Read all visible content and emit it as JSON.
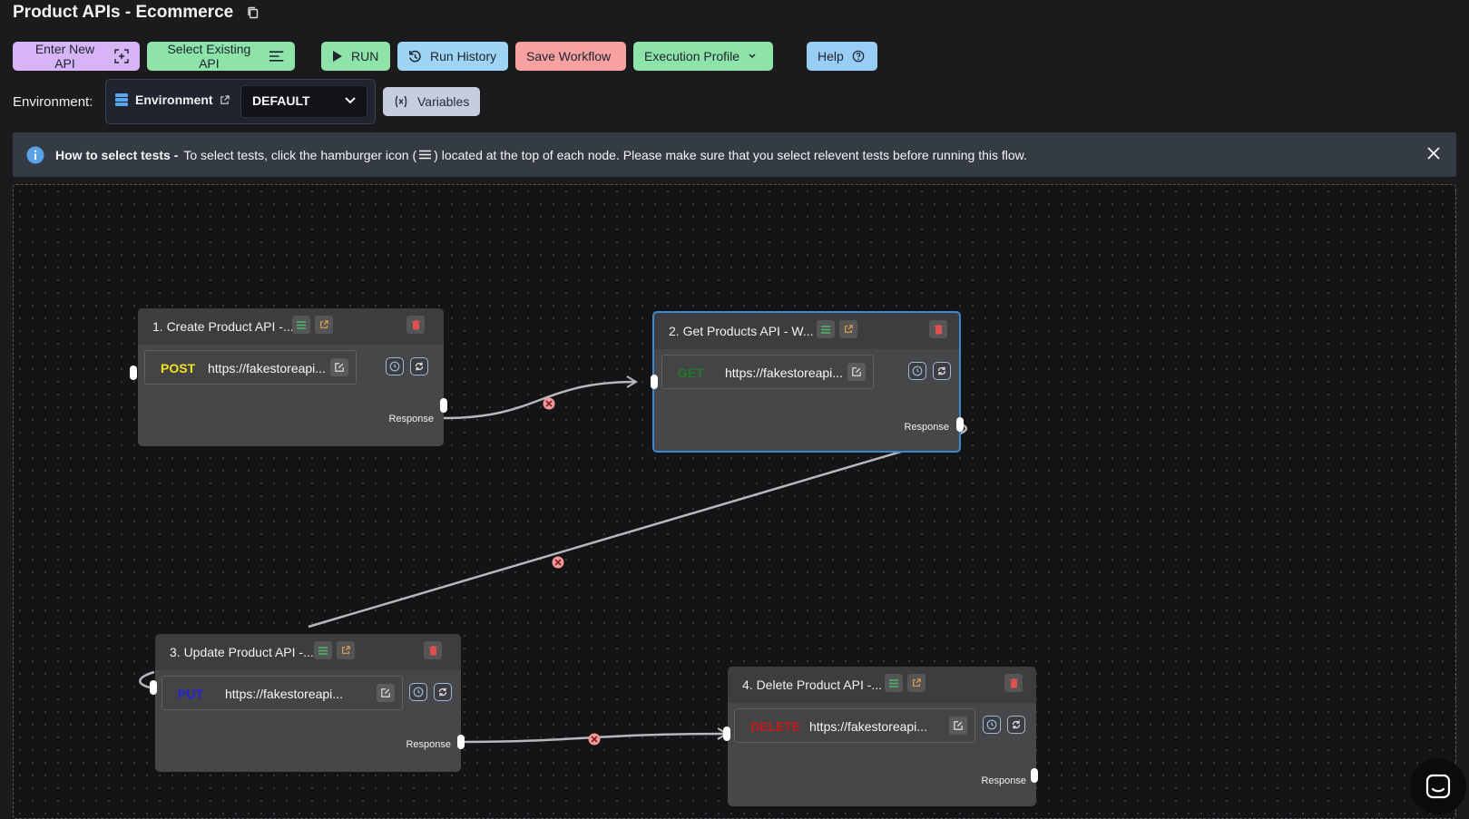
{
  "page": {
    "title": "Product APIs - Ecommerce"
  },
  "toolbar": {
    "enter_new_api": "Enter New API",
    "select_existing_api": "Select Existing API",
    "run": "RUN",
    "run_history": "Run History",
    "save_workflow": "Save Workflow",
    "execution_profile": "Execution Profile",
    "help": "Help"
  },
  "environment": {
    "label": "Environment:",
    "name": "Environment",
    "selected": "DEFAULT",
    "variables_button": "Variables"
  },
  "banner": {
    "heading": "How to select tests -",
    "text_before": "To select tests, click the hamburger icon (",
    "text_after": ") located at the top of each node. Please make sure that you select relevent tests before running this flow."
  },
  "nodes": [
    {
      "title": "1. Create Product API -...",
      "method": "POST",
      "method_color": "#f2e01d",
      "url": "https://fakestoreapi...",
      "response_label": "Response"
    },
    {
      "title": "2. Get Products API - W...",
      "method": "GET",
      "method_color": "#1f7a2a",
      "url": "https://fakestoreapi...",
      "response_label": "Response"
    },
    {
      "title": "3. Update Product API -...",
      "method": "PUT",
      "method_color": "#2323e0",
      "url": "https://fakestoreapi...",
      "response_label": "Response"
    },
    {
      "title": "4. Delete Product API -...",
      "method": "DELETE",
      "method_color": "#c81818",
      "url": "https://fakestoreapi...",
      "response_label": "Response"
    }
  ],
  "colors": {
    "selected_border": "#3a87d4",
    "delete_icon": "#e05050",
    "menu_icon": "#4fb96c",
    "open_icon": "#e0a34a",
    "edge_marker": "#f29a9a"
  },
  "icons": {
    "copy": "copy-icon",
    "enter_new_api": "add-frame-icon",
    "select_existing_api": "list-icon",
    "run": "play-icon",
    "run_history": "history-icon",
    "execution_profile": "chevron-down-icon",
    "help": "help-icon",
    "environment": "database-icon",
    "external": "external-link-icon",
    "variables": "variable-icon",
    "info": "info-icon",
    "close": "close-icon",
    "chat": "chat-icon"
  }
}
